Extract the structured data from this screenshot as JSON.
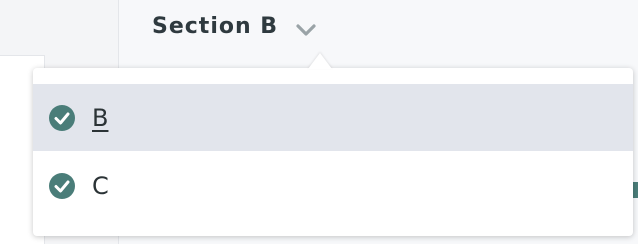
{
  "header": {
    "section_title": "Section B",
    "chevron_icon": "chevron-down-icon"
  },
  "dropdown": {
    "options": [
      {
        "label": "B",
        "selected": true,
        "icon": "check-circle-icon"
      },
      {
        "label": "C",
        "selected": false,
        "icon": "check-circle-icon"
      }
    ]
  },
  "colors": {
    "check_icon": "#4a7d79",
    "selected_row": "#e2e5ec",
    "title_text": "#2f3a3f",
    "chevron": "#9aa3a7"
  }
}
